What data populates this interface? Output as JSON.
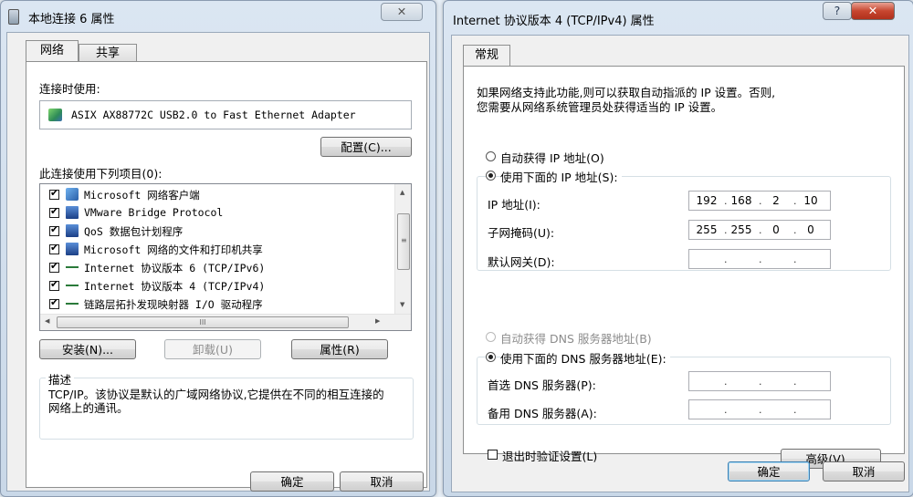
{
  "left": {
    "title": "本地连接 6 属性",
    "tabs": [
      "网络",
      "共享"
    ],
    "connect_using_label": "连接时使用:",
    "adapter": "ASIX AX88772C USB2.0 to Fast Ethernet Adapter",
    "configure_label": "配置(C)...",
    "items_label": "此连接使用下列项目(0):",
    "items": [
      {
        "label": "Microsoft 网络客户端",
        "checked": true,
        "icon": "network-client-icon"
      },
      {
        "label": "VMware Bridge Protocol",
        "checked": true,
        "icon": "network-service-icon"
      },
      {
        "label": "QoS 数据包计划程序",
        "checked": true,
        "icon": "network-service-icon"
      },
      {
        "label": "Microsoft 网络的文件和打印机共享",
        "checked": true,
        "icon": "network-service-icon"
      },
      {
        "label": "Internet 协议版本 6 (TCP/IPv6)",
        "checked": true,
        "icon": "protocol-icon"
      },
      {
        "label": "Internet 协议版本 4 (TCP/IPv4)",
        "checked": true,
        "icon": "protocol-icon"
      },
      {
        "label": "链路层拓扑发现映射器 I/O 驱动程序",
        "checked": true,
        "icon": "protocol-icon"
      }
    ],
    "scroll_label": "III",
    "install_label": "安装(N)...",
    "uninstall_label": "卸载(U)",
    "properties_label": "属性(R)",
    "description_label": "描述",
    "description_text": "TCP/IP。该协议是默认的广域网络协议,它提供在不同的相互连接的网络上的通讯。",
    "ok_label": "确定",
    "cancel_label": "取消",
    "close_glyph": "✕"
  },
  "right": {
    "title": "Internet 协议版本 4 (TCP/IPv4) 属性",
    "help_glyph": "?",
    "close_glyph": "✕",
    "tab": "常规",
    "intro_line1": "如果网络支持此功能,则可以获取自动指派的 IP 设置。否则,",
    "intro_line2": "您需要从网络系统管理员处获得适当的 IP 设置。",
    "auto_ip_label": "自动获得 IP 地址(O)",
    "manual_ip_label": "使用下面的 IP 地址(S):",
    "ip_label": "IP 地址(I):",
    "ip": [
      "192",
      "168",
      "2",
      "10"
    ],
    "mask_label": "子网掩码(U):",
    "mask": [
      "255",
      "255",
      "0",
      "0"
    ],
    "gateway_label": "默认网关(D):",
    "gateway": [
      "",
      "",
      "",
      ""
    ],
    "auto_dns_label": "自动获得 DNS 服务器地址(B)",
    "manual_dns_label": "使用下面的 DNS 服务器地址(E):",
    "preferred_dns_label": "首选 DNS 服务器(P):",
    "preferred_dns": [
      "",
      "",
      "",
      ""
    ],
    "alternate_dns_label": "备用 DNS 服务器(A):",
    "alternate_dns": [
      "",
      "",
      "",
      ""
    ],
    "validate_label": "退出时验证设置(L)",
    "advanced_label": "高级(V)...",
    "ok_label": "确定",
    "cancel_label": "取消",
    "dot": "."
  }
}
